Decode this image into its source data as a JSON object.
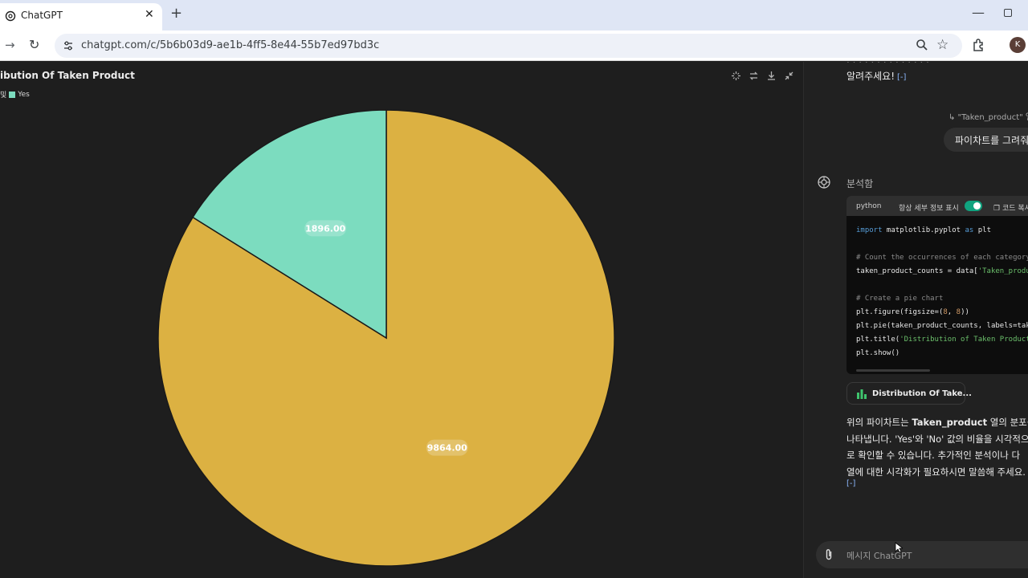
{
  "browser": {
    "tab_title": "ChatGPT",
    "url": "chatgpt.com/c/5b6b03d9-ae1b-4ff5-8e44-55b7ed97bd3c",
    "profile_initial": "K"
  },
  "chart_view": {
    "title": "ibution Of Taken Product",
    "legend_prefix": "및",
    "legend_series": "Yes"
  },
  "chart_data": {
    "type": "pie",
    "title": "Distribution Of Taken Product",
    "slices": [
      {
        "name": "No",
        "value": 9864,
        "label": "9864.00",
        "color": "#dcb142"
      },
      {
        "name": "Yes",
        "value": 1896,
        "label": "1896.00",
        "color": "#7cdcbf"
      }
    ],
    "legend": [
      "Yes"
    ],
    "legend_position": "top-left",
    "start_angle": "12 o'clock",
    "direction": "counterclockwise-yes"
  },
  "chat": {
    "prev_message": "알려주세요!",
    "cite_marker": "[-]",
    "quote": "↳ \"Taken_product\" 열",
    "user_message": "파이차트를 그려줘",
    "status": "분석함",
    "code": {
      "lang": "python",
      "toggle_label": "항상 세부 정보 표시",
      "copy_label": "코드 복사",
      "line1_kw1": "import",
      "line1_mod": " matplotlib.pyplot ",
      "line1_kw2": "as",
      "line1_alias": " plt",
      "line2": "# Count the occurrences of each category",
      "line3_a": "taken_product_counts = data[",
      "line3_b": "'Taken_product'",
      "line4": "# Create a pie chart",
      "line5_a": "plt.figure(figsize=(",
      "line5_n1": "8",
      "line5_sep": ", ",
      "line5_n2": "8",
      "line5_b": "))",
      "line6": "plt.pie(taken_product_counts, labels=taken_",
      "line7_a": "plt.title(",
      "line7_b": "'Distribution of Taken Product'",
      "line8": "plt.show()"
    },
    "chip_label": "Distribution Of Take...",
    "answer": {
      "l1_a": "위의 파이차트는 ",
      "l1_b": "Taken_product",
      "l1_c": " 열의 분포를",
      "l2": "나타냅니다. 'Yes'와 'No' 값의 비율을 시각적으",
      "l3": "로 확인할 수 있습니다. 추가적인 분석이나 다",
      "l4": "열에 대한 시각화가 필요하시면 말씀해 주세요."
    },
    "composer_placeholder": "메시지 ChatGPT"
  }
}
